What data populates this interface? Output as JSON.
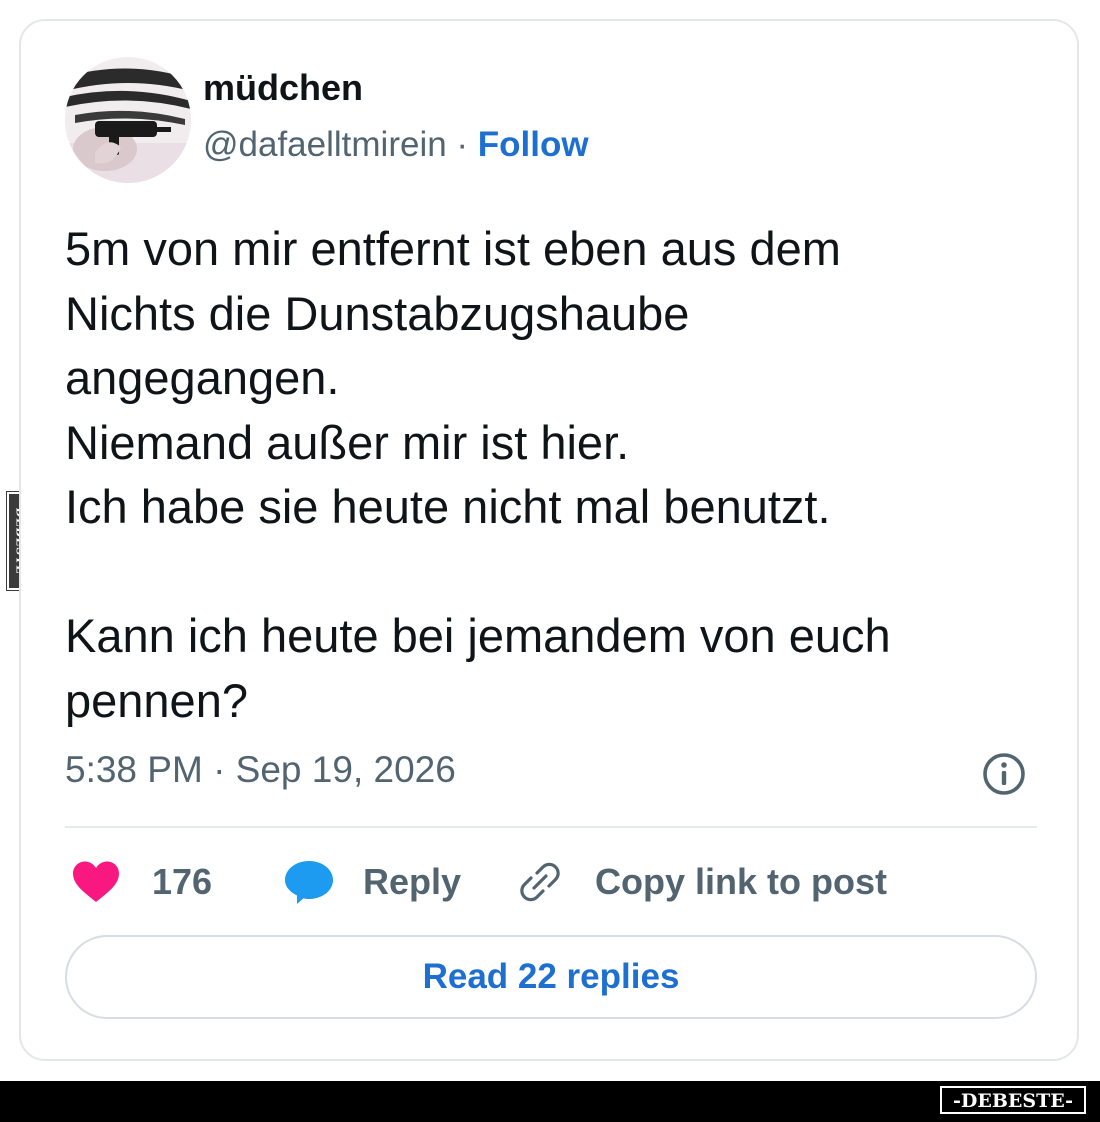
{
  "post": {
    "author_name": "müdchen",
    "handle": "@dafaelltmirein",
    "separator": " · ",
    "follow_label": "Follow",
    "text": "5m von mir entfernt ist eben aus dem\nNichts die Dunstabzugshaube\nangegangen.\nNiemand außer mir ist hier.\nIch habe sie heute nicht mal benutzt.\n\nKann ich heute bei jemandem von euch\npennen?",
    "timestamp": "5:38 PM · Sep 19, 2026"
  },
  "actions": {
    "like_count": "176",
    "reply_label": "Reply",
    "copy_link_label": "Copy link to post"
  },
  "read_replies_label": "Read 22 replies",
  "watermark": {
    "footer_logo_text": "-DEBESTE-",
    "side_text": "DEBESTE"
  },
  "colors": {
    "link_blue": "#1d6fd1",
    "like_pink": "#f91880",
    "reply_blue": "#1d9bf0",
    "text_primary": "#0f1419",
    "text_secondary": "#536471"
  },
  "icons": {
    "like": "heart-icon",
    "reply": "speech-bubble-icon",
    "copy_link": "link-icon",
    "info": "info-icon"
  }
}
